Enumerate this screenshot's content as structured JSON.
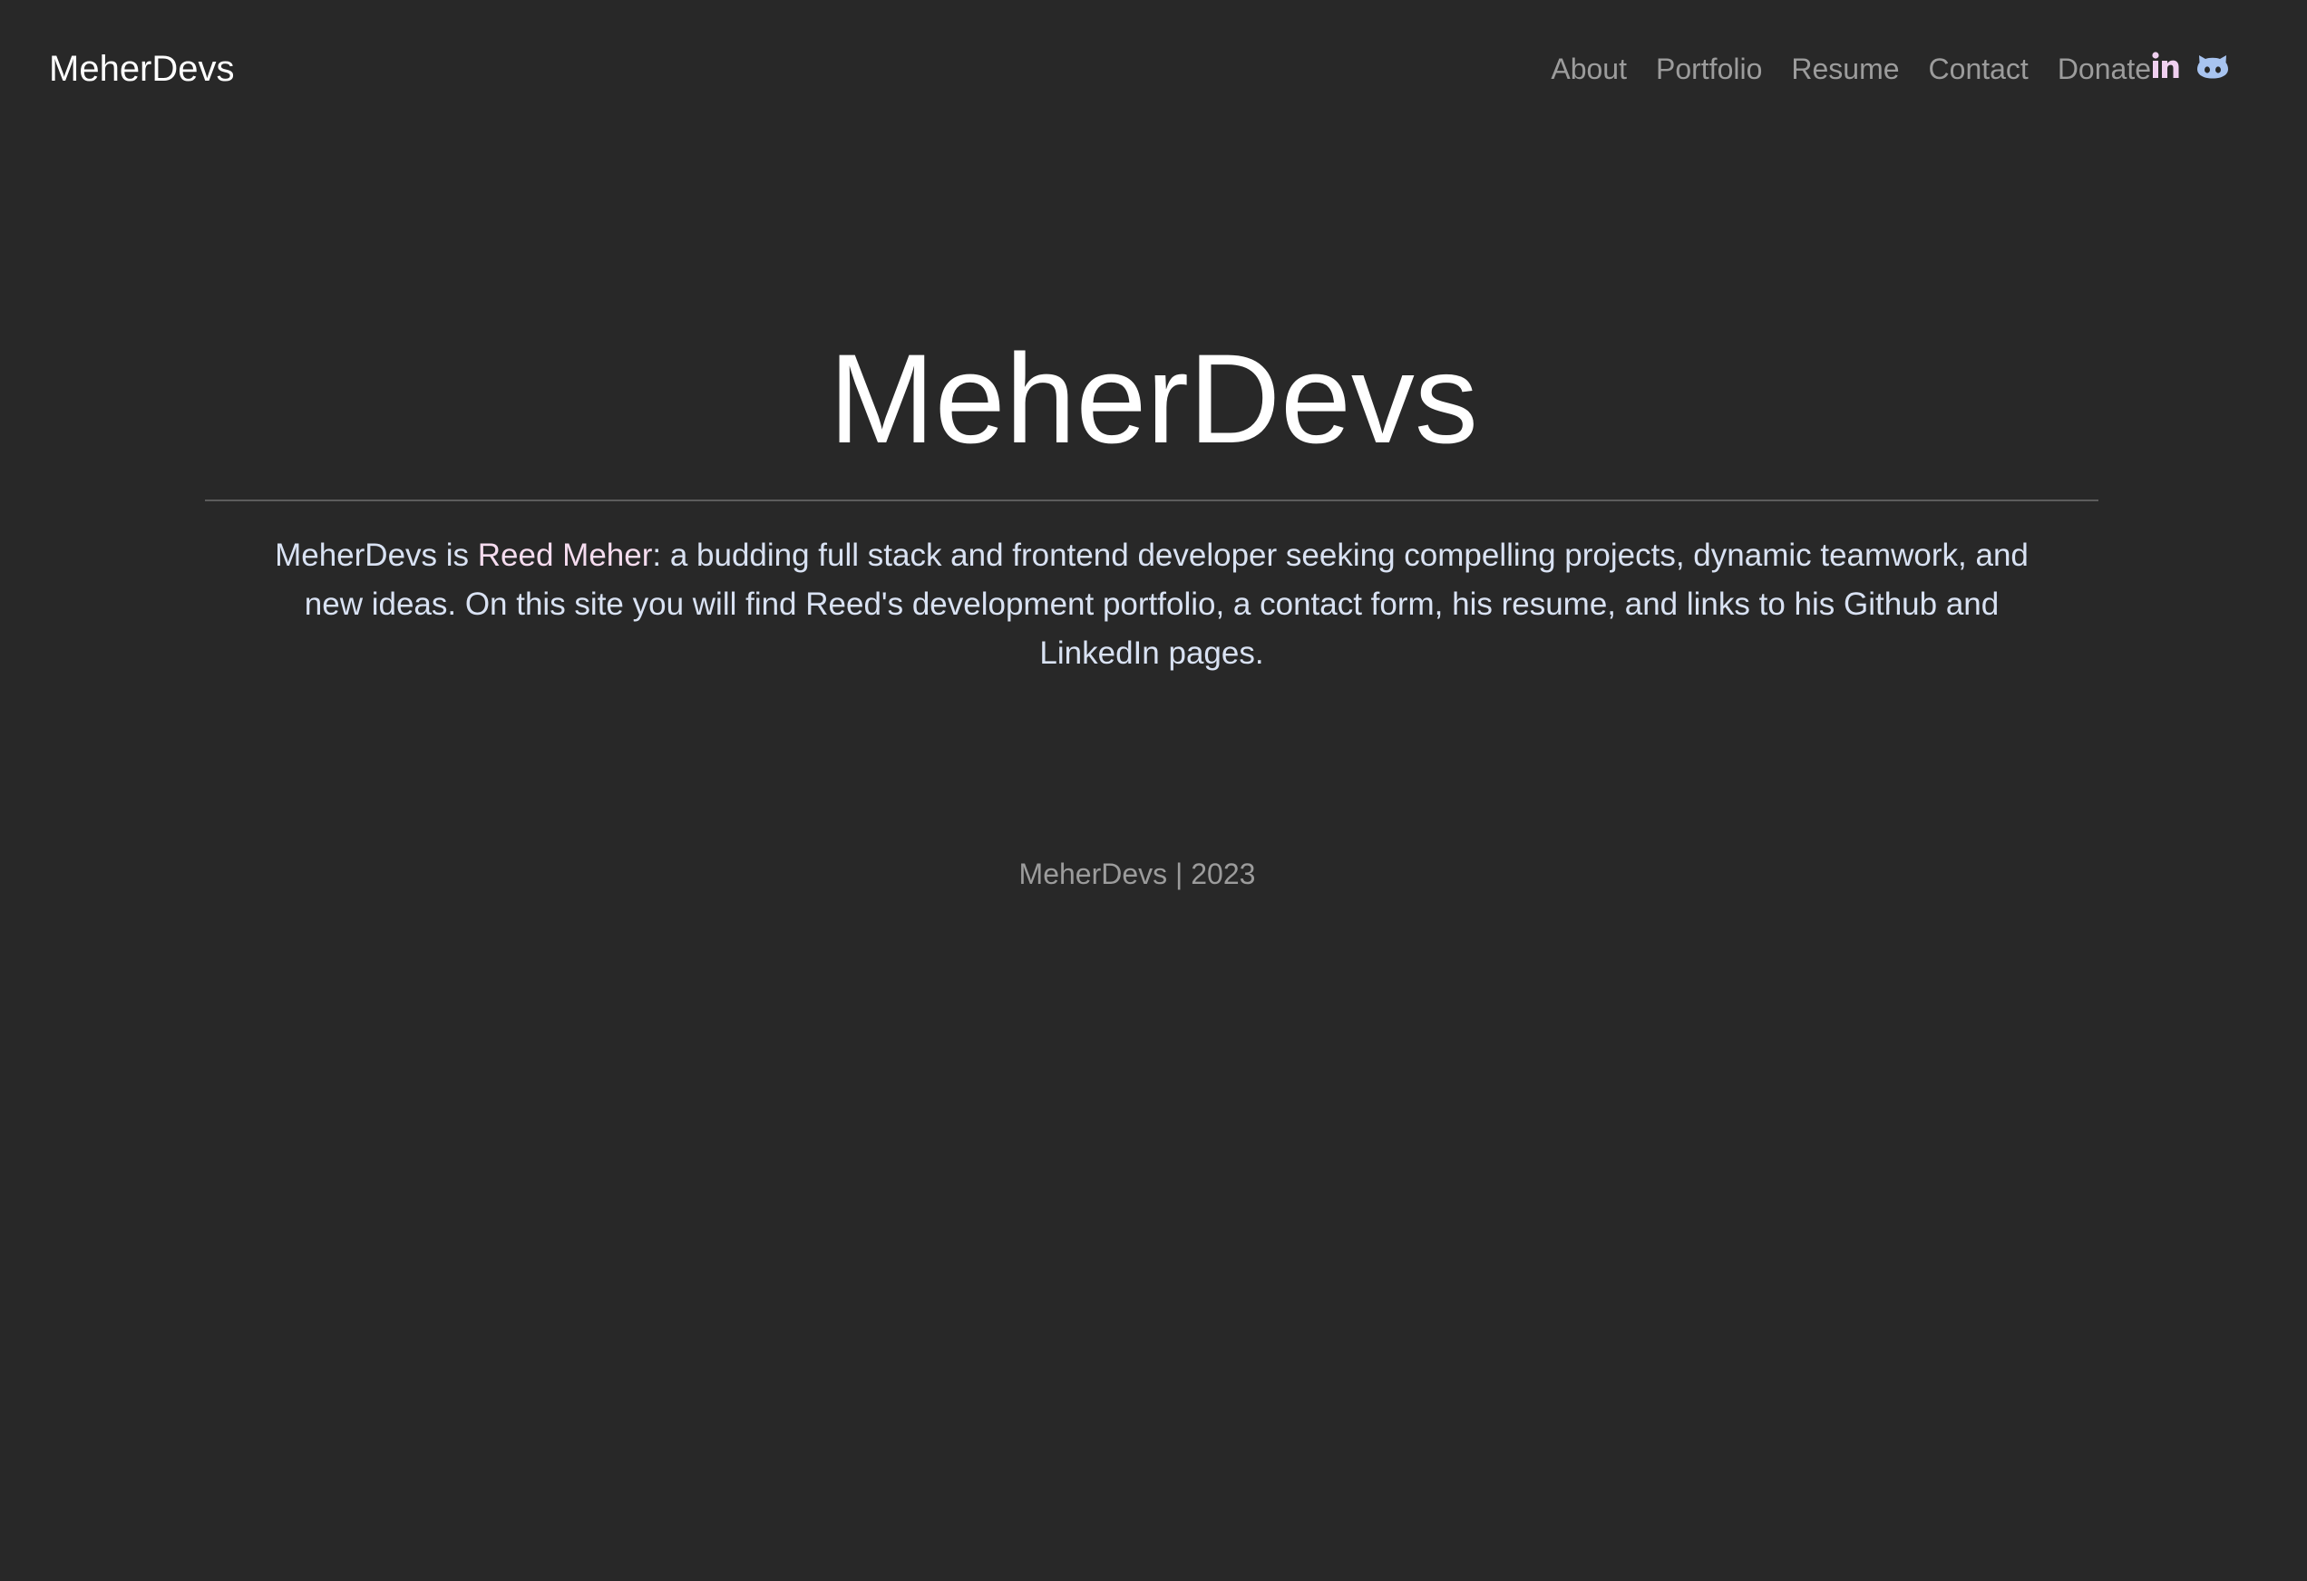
{
  "navbar": {
    "brand": "MeherDevs",
    "links": [
      {
        "label": "About"
      },
      {
        "label": "Portfolio"
      },
      {
        "label": "Resume"
      },
      {
        "label": "Contact"
      },
      {
        "label": "Donate"
      }
    ],
    "social": [
      {
        "icon": "linkedin-icon",
        "color": "#f0d0f0"
      },
      {
        "icon": "github-icon",
        "color": "#a8c4f0"
      }
    ]
  },
  "hero": {
    "title": "MeherDevs",
    "bio_prefix": "MeherDevs is ",
    "bio_name": "Reed Meher",
    "bio_suffix": ": a budding full stack and frontend developer seeking compelling projects, dynamic teamwork, and new ideas. On this site you will find Reed's development portfolio, a contact form, his resume, and links to his Github and LinkedIn pages."
  },
  "footer": {
    "text": "MeherDevs | 2023"
  },
  "colors": {
    "background": "#282828",
    "text_primary": "#ffffff",
    "text_muted": "#9c9c9c",
    "bio_text": "#d9e2f3",
    "name_highlight": "#f6dcef"
  }
}
